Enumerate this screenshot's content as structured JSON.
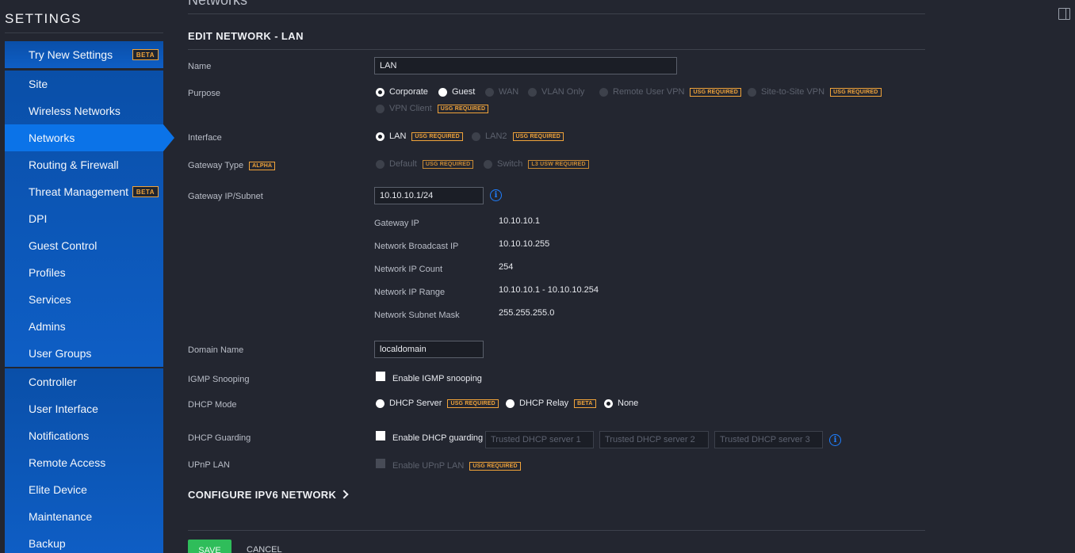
{
  "sidebar": {
    "title": "SETTINGS",
    "top_item": {
      "label": "Try New Settings",
      "badge": "BETA"
    },
    "group1": [
      {
        "label": "Site"
      },
      {
        "label": "Wireless Networks"
      },
      {
        "label": "Networks",
        "active": true
      },
      {
        "label": "Routing & Firewall"
      },
      {
        "label": "Threat Management",
        "badge": "BETA"
      },
      {
        "label": "DPI"
      },
      {
        "label": "Guest Control"
      },
      {
        "label": "Profiles"
      },
      {
        "label": "Services"
      },
      {
        "label": "Admins"
      },
      {
        "label": "User Groups"
      }
    ],
    "group2": [
      {
        "label": "Controller"
      },
      {
        "label": "User Interface"
      },
      {
        "label": "Notifications"
      },
      {
        "label": "Remote Access"
      },
      {
        "label": "Elite Device"
      },
      {
        "label": "Maintenance"
      },
      {
        "label": "Backup"
      }
    ]
  },
  "main": {
    "section_title": "Networks",
    "edit_title": "EDIT NETWORK - LAN",
    "name": {
      "label": "Name",
      "value": "LAN"
    },
    "purpose": {
      "label": "Purpose",
      "options": {
        "corporate": "Corporate",
        "guest": "Guest",
        "wan": "WAN",
        "vlan_only": "VLAN Only",
        "remote_user_vpn": "Remote User VPN",
        "site_to_site_vpn": "Site-to-Site VPN",
        "vpn_client": "VPN Client"
      },
      "selected": "Corporate"
    },
    "interface": {
      "label": "Interface",
      "lan": "LAN",
      "lan2": "LAN2",
      "selected": "LAN"
    },
    "gateway_type": {
      "label": "Gateway Type",
      "badge": "ALPHA",
      "default": "Default",
      "switch": "Switch",
      "switch_badge": "L3 USW REQUIRED"
    },
    "gateway_ip_subnet": {
      "label": "Gateway IP/Subnet",
      "value": "10.10.10.1/24"
    },
    "details": {
      "gateway_ip": {
        "label": "Gateway IP",
        "value": "10.10.10.1"
      },
      "broadcast_ip": {
        "label": "Network Broadcast IP",
        "value": "10.10.10.255"
      },
      "ip_count": {
        "label": "Network IP Count",
        "value": "254"
      },
      "ip_range": {
        "label": "Network IP Range",
        "value": "10.10.10.1 - 10.10.10.254"
      },
      "subnet_mask": {
        "label": "Network Subnet Mask",
        "value": "255.255.255.0"
      }
    },
    "domain_name": {
      "label": "Domain Name",
      "value": "localdomain"
    },
    "igmp": {
      "label": "IGMP Snooping",
      "option": "Enable IGMP snooping",
      "checked": false
    },
    "dhcp_mode": {
      "label": "DHCP Mode",
      "server": "DHCP Server",
      "relay": "DHCP Relay",
      "relay_badge": "BETA",
      "none": "None",
      "selected": "None"
    },
    "dhcp_guarding": {
      "label": "DHCP Guarding",
      "option": "Enable DHCP guarding",
      "checked": false,
      "placeholders": [
        "Trusted DHCP server 1",
        "Trusted DHCP server 2",
        "Trusted DHCP server 3"
      ]
    },
    "upnp": {
      "label": "UPnP LAN",
      "option": "Enable UPnP LAN"
    },
    "usg_required": "USG REQUIRED",
    "ipv6_link": "CONFIGURE IPV6 NETWORK",
    "save": "SAVE",
    "cancel": "CANCEL",
    "info_glyph": "i"
  },
  "icons": {
    "info": "info-icon",
    "chevron": "chevron-right-icon",
    "panel": "panel-toggle-icon"
  },
  "colors": {
    "accent": "#0b73e8",
    "badge": "#f0a33a",
    "save": "#2fbd5a",
    "background": "#232630"
  }
}
